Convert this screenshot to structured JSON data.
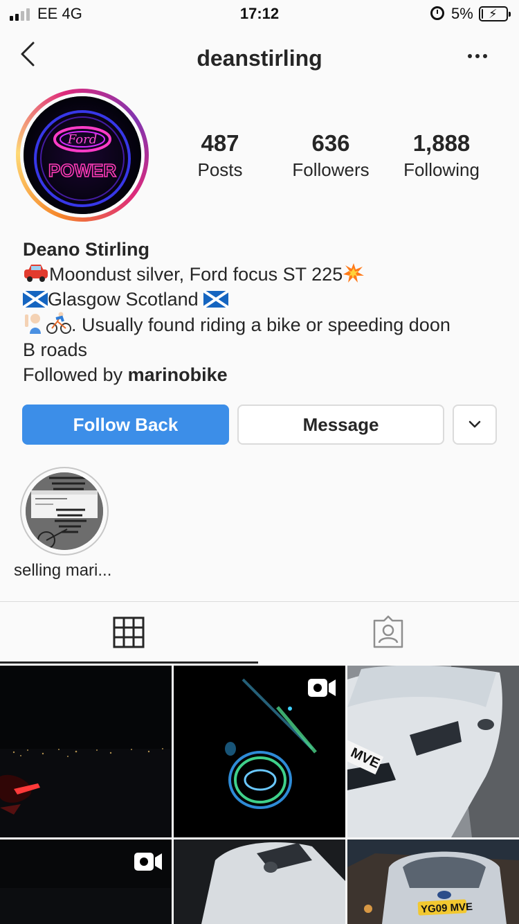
{
  "status_bar": {
    "carrier": "EE 4G",
    "time": "17:12",
    "battery_percent": "5%",
    "battery_level": 0.05,
    "signal_bars": 4,
    "signal_bars_active": 2
  },
  "header": {
    "username": "deanstirling",
    "back_icon": "chevron-left-icon",
    "more_icon": "ellipsis-icon"
  },
  "profile": {
    "avatar_text": "POWER",
    "stats": [
      {
        "value": "487",
        "label": "Posts"
      },
      {
        "value": "636",
        "label": "Followers"
      },
      {
        "value": "1,888",
        "label": "Following"
      }
    ],
    "name": "Deano Stirling",
    "bio_lines": [
      "Moondust silver, Ford focus ST 225",
      "Glasgow Scotland",
      ". Usually found riding a bike or speeding doon",
      "B roads"
    ],
    "followed_by_prefix": "Followed by ",
    "followed_by_user": "marinobike"
  },
  "actions": {
    "follow_back": "Follow Back",
    "message": "Message",
    "follow_color": "#3c8ee8"
  },
  "highlights": [
    {
      "label": "selling mari..."
    }
  ],
  "tabs": {
    "grid_icon": "grid-icon",
    "tagged_icon": "tagged-user-icon",
    "active": "grid"
  },
  "posts": [
    {
      "kind": "photo",
      "video": false
    },
    {
      "kind": "video",
      "video": true
    },
    {
      "kind": "photo",
      "video": false
    },
    {
      "kind": "video",
      "video": true
    },
    {
      "kind": "photo",
      "video": false
    },
    {
      "kind": "photo",
      "video": false
    }
  ]
}
